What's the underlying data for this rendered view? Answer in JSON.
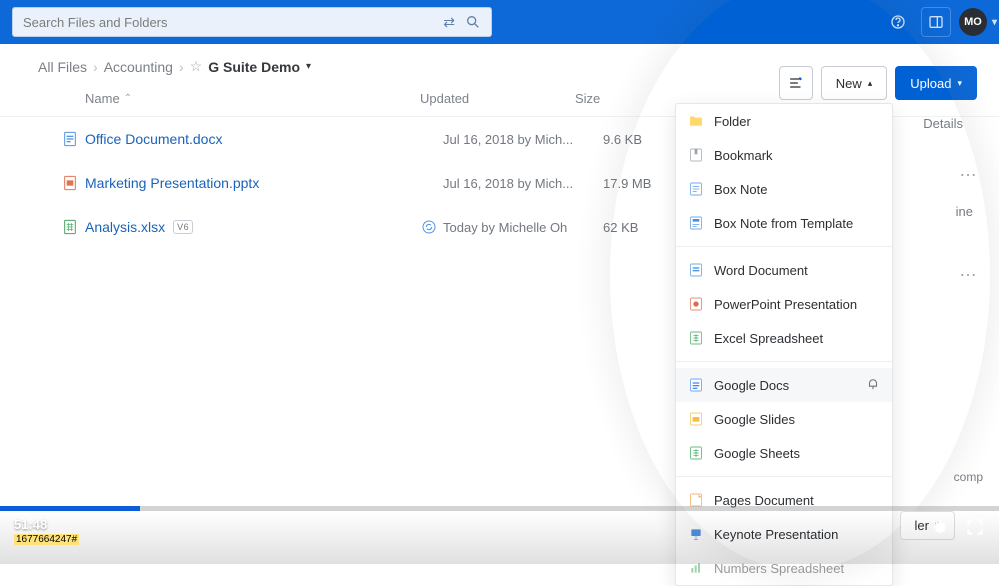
{
  "search": {
    "placeholder": "Search Files and Folders"
  },
  "avatar": {
    "initials": "MO"
  },
  "breadcrumbs": {
    "root": "All Files",
    "mid": "Accounting",
    "current": "G Suite Demo"
  },
  "buttons": {
    "new": "New",
    "upload": "Upload"
  },
  "columns": {
    "name": "Name",
    "updated": "Updated",
    "size": "Size",
    "details": "Details"
  },
  "files": [
    {
      "name": "Office Document.docx",
      "updated": "Jul 16, 2018 by Mich...",
      "size": "9.6 KB",
      "type": "docx",
      "badge": "",
      "sync": false
    },
    {
      "name": "Marketing Presentation.pptx",
      "updated": "Jul 16, 2018 by Mich...",
      "size": "17.9 MB",
      "type": "pptx",
      "badge": "",
      "sync": false
    },
    {
      "name": "Analysis.xlsx",
      "updated": "Today by Michelle Oh",
      "size": "62 KB",
      "type": "xlsx",
      "badge": "V6",
      "sync": true
    }
  ],
  "sidebar_hint": "ine",
  "new_menu": {
    "section1": [
      "Folder",
      "Bookmark",
      "Box Note",
      "Box Note from Template"
    ],
    "section2": [
      "Word Document",
      "PowerPoint Presentation",
      "Excel Spreadsheet"
    ],
    "section3": [
      "Google Docs",
      "Google Slides",
      "Google Sheets"
    ],
    "section4": [
      "Pages Document",
      "Keynote Presentation",
      "Numbers Spreadsheet"
    ]
  },
  "footer": {
    "comp": "comp",
    "folder": "ler"
  },
  "video": {
    "time": "51:48",
    "id": "1677664247#"
  }
}
